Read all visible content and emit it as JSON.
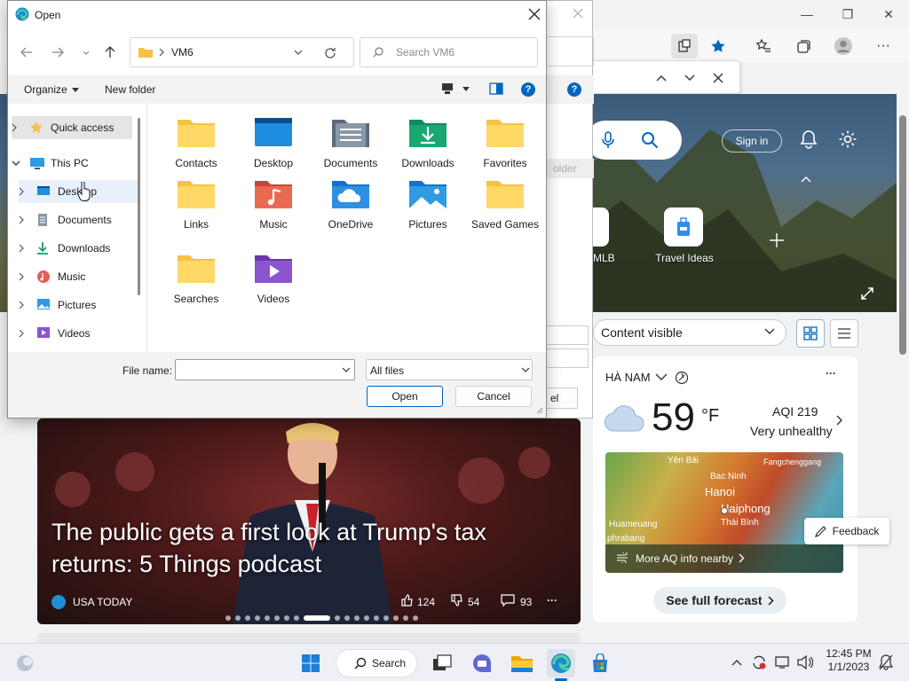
{
  "browser": {
    "minimize": "—",
    "restore": "❐",
    "close": "✕",
    "more": "···",
    "signin": "Sign in",
    "tiles": [
      {
        "label": "MLB"
      },
      {
        "label": "Travel Ideas"
      }
    ],
    "content_select": "Content visible",
    "news": {
      "title": "The public gets a first look at Trump's tax returns: 5 Things podcast",
      "source": "USA TODAY",
      "likes": "124",
      "dislikes": "54",
      "comments": "93",
      "more": "···"
    },
    "weather": {
      "location": "HÀ NAM",
      "temp": "59",
      "unit": "°F",
      "aqi": "AQI 219",
      "aqi_status": "Very unhealthy",
      "map_labels": [
        "Yên Bái",
        "Bac Ninh",
        "Fangchenggang",
        "Hanoi",
        "Haiphong",
        "Huameuang",
        "Thái Bình",
        "phrabang"
      ],
      "more_aq": "More AQ info nearby",
      "forecast": "See full forecast"
    },
    "feedback": "Feedback",
    "underlay": {
      "folder": "older",
      "cancel": "el"
    }
  },
  "dialog": {
    "title": "Open",
    "address": "VM6",
    "search_placeholder": "Search VM6",
    "organize": "Organize",
    "new_folder": "New folder",
    "nav_tree": [
      {
        "label": "Quick access",
        "icon": "star-icon"
      },
      {
        "label": "This PC",
        "icon": "pc-icon"
      },
      {
        "label": "Desktop",
        "icon": "desktop-icon"
      },
      {
        "label": "Documents",
        "icon": "documents-icon"
      },
      {
        "label": "Downloads",
        "icon": "downloads-icon"
      },
      {
        "label": "Music",
        "icon": "music-icon"
      },
      {
        "label": "Pictures",
        "icon": "pictures-icon"
      },
      {
        "label": "Videos",
        "icon": "videos-icon"
      }
    ],
    "files": [
      {
        "label": "Contacts"
      },
      {
        "label": "Desktop"
      },
      {
        "label": "Documents"
      },
      {
        "label": "Downloads"
      },
      {
        "label": "Favorites"
      },
      {
        "label": "Links"
      },
      {
        "label": "Music"
      },
      {
        "label": "OneDrive"
      },
      {
        "label": "Pictures"
      },
      {
        "label": "Saved Games"
      },
      {
        "label": "Searches"
      },
      {
        "label": "Videos"
      }
    ],
    "file_name_label": "File name:",
    "file_name_value": "",
    "file_type": "All files",
    "open_btn": "Open",
    "cancel_btn": "Cancel"
  },
  "taskbar": {
    "search": "Search",
    "time": "12:45 PM",
    "date": "1/1/2023"
  },
  "colors": {
    "folder": "#f6c244",
    "accent": "#0067c0"
  }
}
